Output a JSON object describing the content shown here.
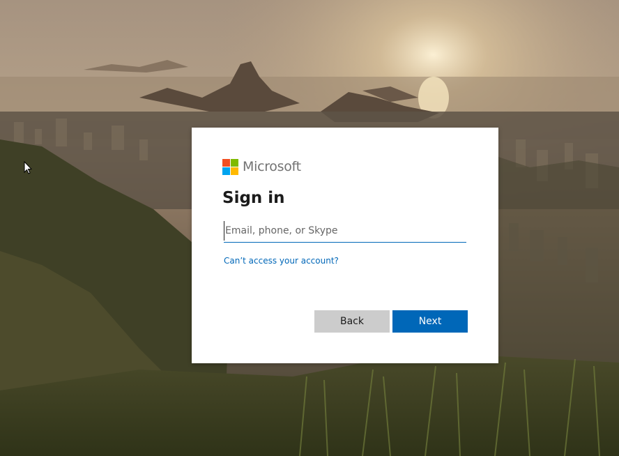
{
  "brand": {
    "name": "Microsoft",
    "logo_colors": [
      "#f25022",
      "#7fba00",
      "#00a4ef",
      "#ffb900"
    ]
  },
  "form": {
    "title": "Sign in",
    "email_placeholder": "Email, phone, or Skype",
    "email_value": "",
    "cant_access_link": "Can’t access your account?",
    "back_label": "Back",
    "next_label": "Next"
  },
  "theme": {
    "accent": "#0067b8",
    "back_button_bg": "#cccccc"
  },
  "background": {
    "scene": "sunset-over-bay-with-mountains"
  }
}
